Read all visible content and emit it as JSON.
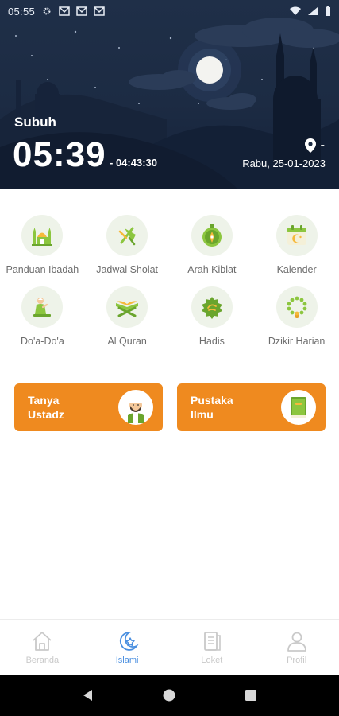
{
  "status_bar": {
    "time": "05:55"
  },
  "header": {
    "prayer_name": "Subuh",
    "prayer_time": "05:39",
    "countdown": "- 04:43:30",
    "location": "-",
    "date": "Rabu, 25-01-2023"
  },
  "menu": [
    {
      "label": "Panduan Ibadah",
      "icon": "mosque-icon"
    },
    {
      "label": "Jadwal Sholat",
      "icon": "prayer-schedule-icon"
    },
    {
      "label": "Arah Kiblat",
      "icon": "compass-icon"
    },
    {
      "label": "Kalender",
      "icon": "calendar-icon"
    },
    {
      "label": "Do'a-Do'a",
      "icon": "praying-person-icon"
    },
    {
      "label": "Al Quran",
      "icon": "quran-stand-icon"
    },
    {
      "label": "Hadis",
      "icon": "hadith-icon"
    },
    {
      "label": "Dzikir Harian",
      "icon": "prayer-beads-icon"
    }
  ],
  "cards": [
    {
      "label": "Tanya\nUstadz",
      "icon": "ustadz-avatar-icon"
    },
    {
      "label": "Pustaka\nIlmu",
      "icon": "book-icon"
    }
  ],
  "bottom_nav": [
    {
      "label": "Beranda",
      "icon": "home-icon",
      "active": false
    },
    {
      "label": "Islami",
      "icon": "crescent-star-icon",
      "active": true
    },
    {
      "label": "Loket",
      "icon": "document-icon",
      "active": false
    },
    {
      "label": "Profil",
      "icon": "profile-icon",
      "active": false
    }
  ],
  "colors": {
    "accent_orange": "#ef8a1f",
    "icon_green": "#8cc63f",
    "active_blue": "#4a8fe0",
    "header_bg": "#1f2f48"
  }
}
